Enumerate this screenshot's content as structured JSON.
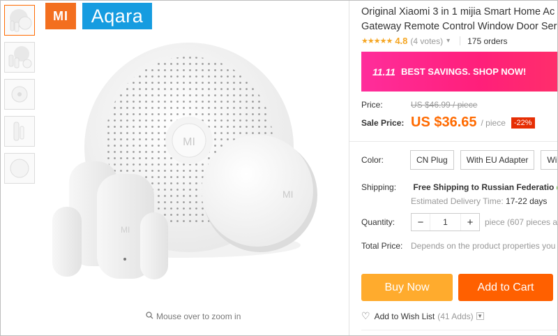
{
  "brand": {
    "mi_logo": "MI",
    "aqara_logo": "Aqara"
  },
  "gallery": {
    "thumbnails": [
      "hub-and-sensors",
      "kit-set",
      "wireless-switch",
      "door-window-sensor",
      "round-button"
    ],
    "zoom_hint": "Mouse over to zoom in"
  },
  "product": {
    "title_line1": "Original Xiaomi 3 in 1 mijia Smart Home Ac",
    "title_line2": "Gateway Remote Control Window Door Ser",
    "stars": "★★★★★",
    "rating": "4.8",
    "votes": "(4 votes)",
    "orders": "175 orders"
  },
  "banner": {
    "tag": "11.11",
    "text": "BEST SAVINGS. SHOP NOW!"
  },
  "pricing": {
    "price_label": "Price:",
    "old_price": "US $46.99 / piece",
    "sale_label": "Sale Price:",
    "sale_price": "US $36.65",
    "per_piece": "/ piece",
    "discount": "-22%"
  },
  "color": {
    "label": "Color:",
    "options": [
      "CN Plug",
      "With EU Adapter",
      "Wi"
    ]
  },
  "shipping": {
    "label": "Shipping:",
    "value": "Free Shipping to Russian Federatio",
    "delivery_prefix": "Estimated Delivery Time:",
    "delivery_days": "17-22 days"
  },
  "quantity": {
    "label": "Quantity:",
    "minus": "−",
    "value": "1",
    "plus": "+",
    "note": "piece (607 pieces av"
  },
  "total": {
    "label": "Total Price:",
    "note": "Depends on the product properties you"
  },
  "actions": {
    "buy_now": "Buy Now",
    "add_to_cart": "Add to Cart",
    "wishlist": "Add to Wish List",
    "wishlist_count": "(41 Adds)"
  },
  "colors": {
    "accent": "#ff6a00",
    "buy": "#ffab2d",
    "cart": "#ff6000",
    "banner": "#ff2d9b",
    "discount": "#e62e04"
  }
}
